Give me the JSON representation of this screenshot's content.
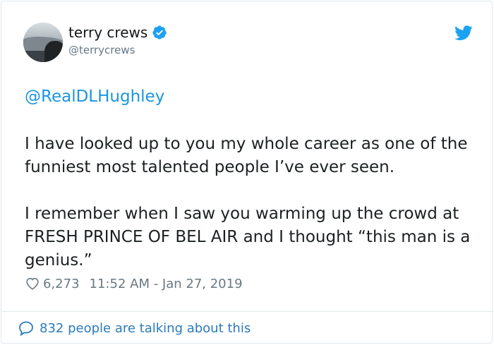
{
  "author": {
    "name": "terry crews",
    "handle": "@terrycrews",
    "verified": true
  },
  "tweet": {
    "mention": "@RealDLHughley",
    "paragraphs": [
      "I have looked up to you my whole career as one of the funniest most talented people I’ve ever seen.",
      "I remember when I saw you warming up the crowd at FRESH PRINCE OF BEL AIR and I thought “this man is a genius.”"
    ]
  },
  "meta": {
    "likes": "6,273",
    "timestamp": "11:52 AM - Jan 27, 2019"
  },
  "footer": {
    "talking": "832 people are talking about this"
  },
  "colors": {
    "link": "#1b95e0",
    "muted": "#657786",
    "twitter_blue": "#1da1f2"
  },
  "icons": [
    "verified-badge-icon",
    "twitter-bird-icon",
    "heart-icon",
    "speech-bubble-icon"
  ]
}
